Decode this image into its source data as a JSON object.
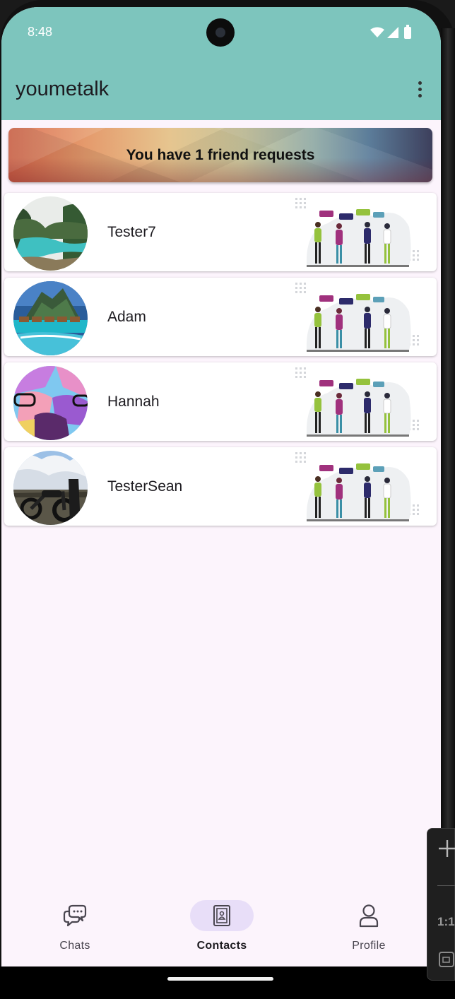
{
  "status_bar": {
    "time": "8:48",
    "icons": [
      "wifi-icon",
      "signal-icon",
      "battery-icon"
    ]
  },
  "app_bar": {
    "title": "youmetalk",
    "menu_icon": "more-vert-icon"
  },
  "banner": {
    "text": "You have 1 friend requests"
  },
  "contacts": [
    {
      "name": "Tester7",
      "avatar": "river-landscape-photo"
    },
    {
      "name": "Adam",
      "avatar": "tropical-island-photo"
    },
    {
      "name": "Hannah",
      "avatar": "cartoon-art-avatar"
    },
    {
      "name": "TesterSean",
      "avatar": "motorcycle-photo"
    }
  ],
  "bottom_nav": {
    "items": [
      {
        "label": "Chats",
        "icon": "chat-bubbles-icon",
        "active": false
      },
      {
        "label": "Contacts",
        "icon": "contacts-book-icon",
        "active": true
      },
      {
        "label": "Profile",
        "icon": "person-icon",
        "active": false
      }
    ]
  },
  "emulator_panel": {
    "ratio_label": "1:1"
  },
  "colors": {
    "header": "#7dc5bd",
    "background": "#fcf4fc",
    "nav_active_pill": "#e8def8"
  }
}
